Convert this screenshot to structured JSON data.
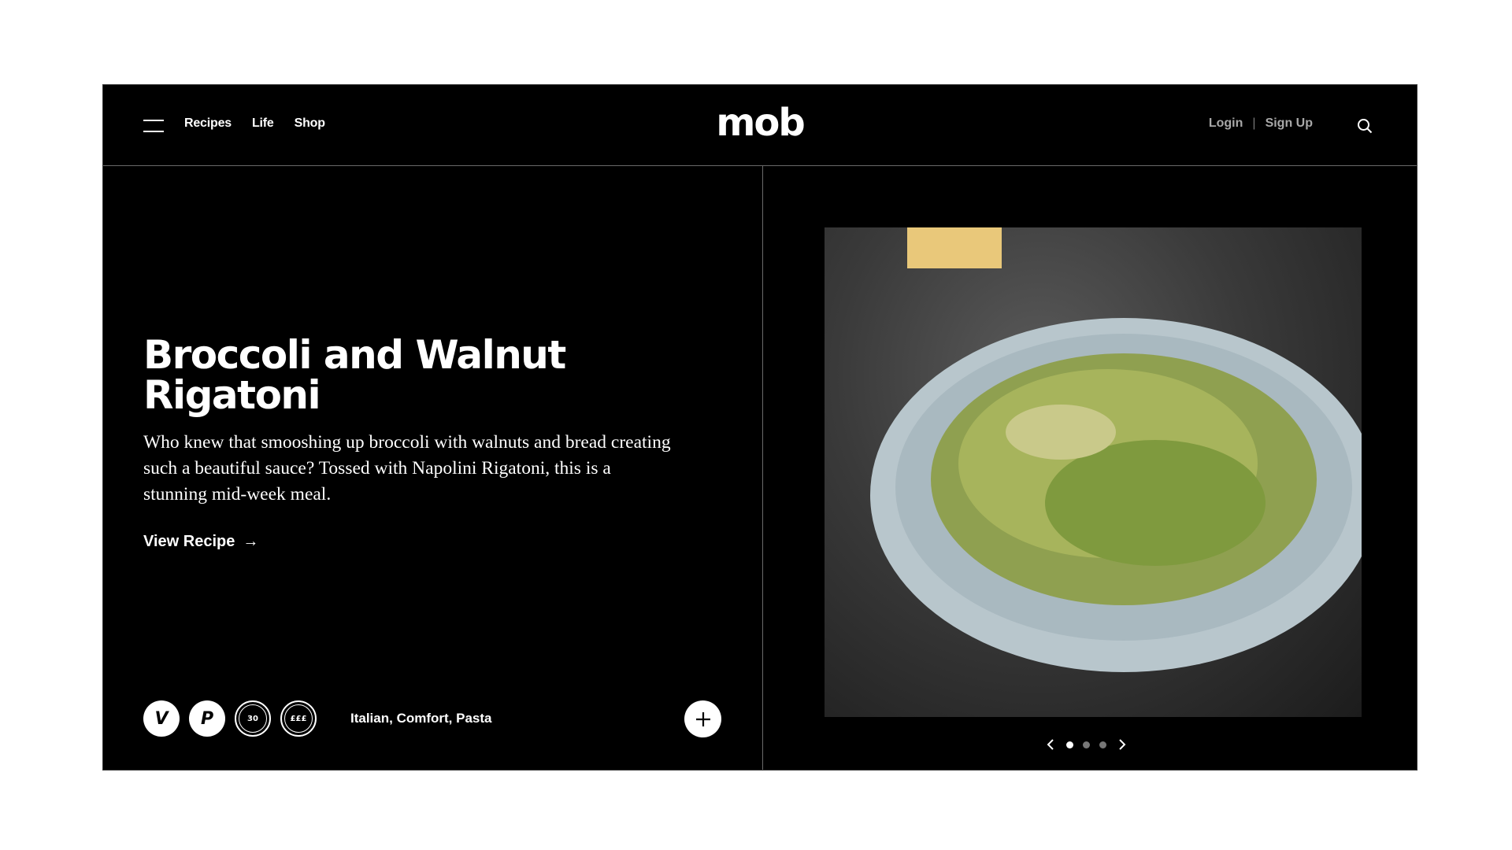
{
  "header": {
    "nav": [
      {
        "label": "Recipes"
      },
      {
        "label": "Life"
      },
      {
        "label": "Shop"
      }
    ],
    "logo": "mob",
    "login": "Login",
    "separator": "|",
    "signup": "Sign Up"
  },
  "hero": {
    "title": "Broccoli and Walnut Rigatoni",
    "description": "Who knew that smooshing up broccoli with walnuts and bread creating such a beautiful sauce? Tossed with Napolini Rigatoni, this is a stunning mid-week meal.",
    "cta": "View Recipe",
    "cta_arrow": "→",
    "badges": {
      "vegetarian": "V",
      "p": "P",
      "time": "30",
      "price_top": "£",
      "price_bottom": "££"
    },
    "tags": "Italian, Comfort, Pasta"
  },
  "carousel": {
    "slide_count": 3,
    "active_index": 0
  },
  "colors": {
    "background": "#000000",
    "text": "#ffffff",
    "muted": "#a8a8a8",
    "divider": "#6a6a6a"
  },
  "icons": [
    "menu-icon",
    "search-icon",
    "arrow-right-icon",
    "plus-icon",
    "chevron-left-icon",
    "chevron-right-icon"
  ]
}
